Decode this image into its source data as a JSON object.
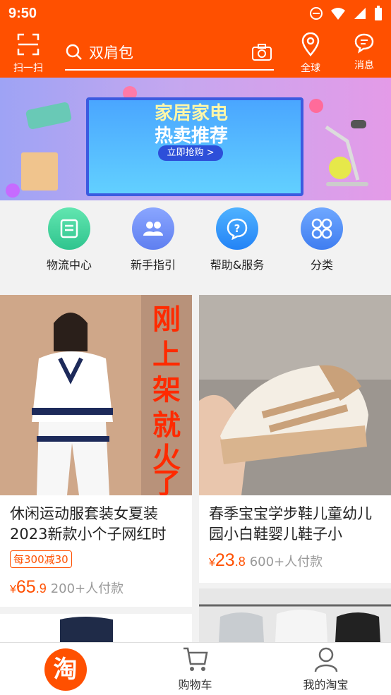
{
  "status_bar": {
    "time": "9:50"
  },
  "header": {
    "scan_label": "扫一扫",
    "search_query": "双肩包",
    "global_label": "全球",
    "messages_label": "消息"
  },
  "banner": {
    "line1": "家居家电",
    "line2": "热卖推荐",
    "button": "立即抢购 >"
  },
  "shortcuts": [
    {
      "label": "物流中心",
      "color": "#38d59b"
    },
    {
      "label": "新手指引",
      "color": "#6b88f2"
    },
    {
      "label": "帮助&服务",
      "color": "#2f8dfa"
    },
    {
      "label": "分类",
      "color": "#4b8ff4"
    }
  ],
  "products": [
    {
      "title": "休闲运动服套装女夏装2023新款小个子网红时",
      "promo": "每300减30",
      "price_currency": "¥",
      "price_int": "65",
      "price_dec": ".9",
      "sold": "200+人付款",
      "image_text": [
        "刚",
        "上",
        "架",
        "就",
        "火",
        "了"
      ]
    },
    {
      "title": "春季宝宝学步鞋儿童幼儿园小白鞋婴儿鞋子小",
      "price_currency": "¥",
      "price_int": "23",
      "price_dec": ".8",
      "sold": "600+人付款"
    }
  ],
  "tabbar": {
    "home_logo": "淘",
    "cart_label": "购物车",
    "mine_label": "我的淘宝"
  }
}
